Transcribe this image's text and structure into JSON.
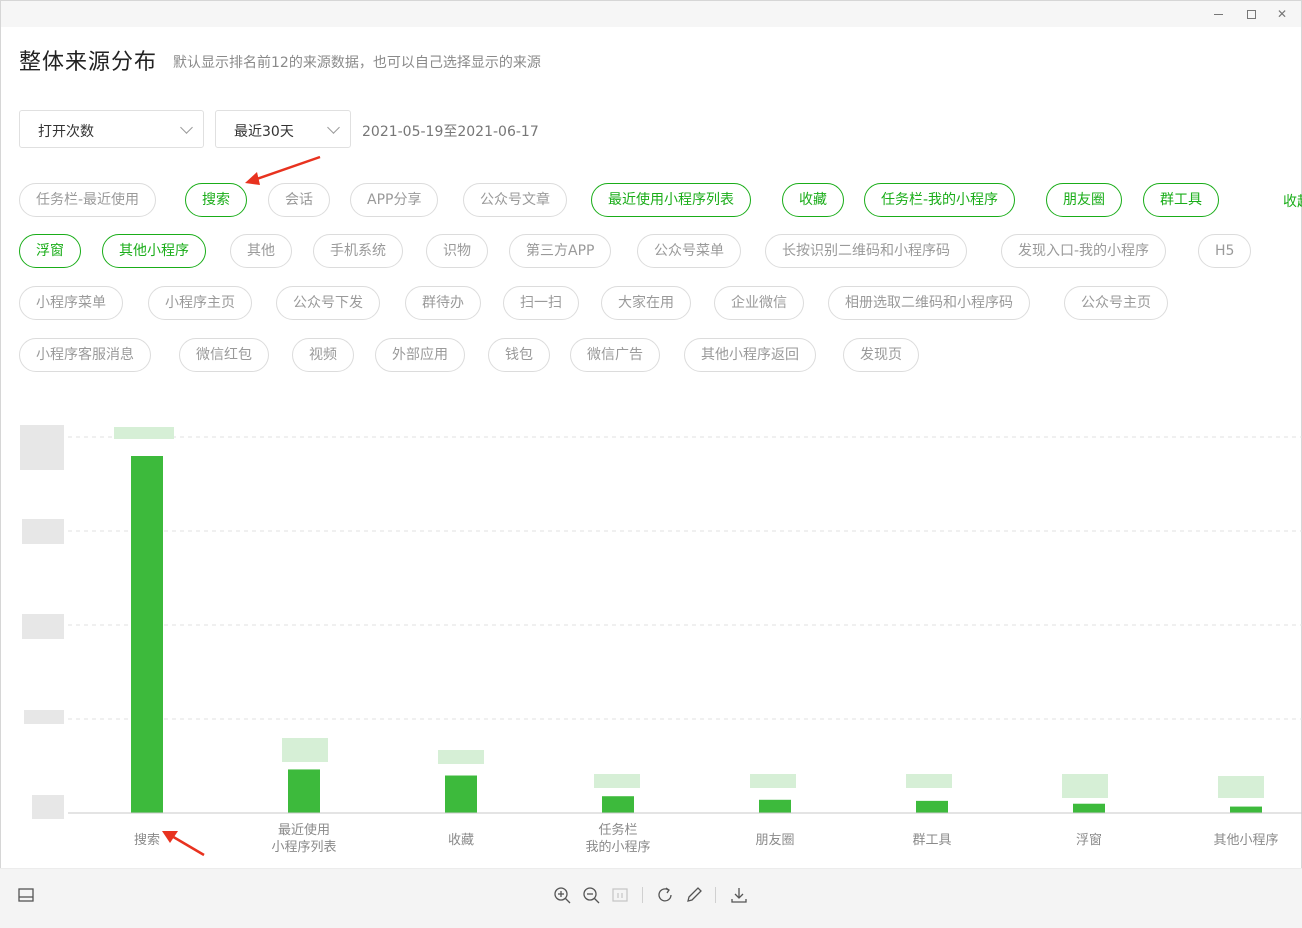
{
  "header": {
    "title": "整体来源分布",
    "subtitle": "默认显示排名前12的来源数据，也可以自己选择显示的来源"
  },
  "filters": {
    "metric": "打开次数",
    "range": "最近30天",
    "date_range": "2021-05-19至2021-06-17"
  },
  "tags_collapse_label": "收起",
  "tags": [
    {
      "label": "任务栏-最近使用",
      "selected": false
    },
    {
      "label": "搜索",
      "selected": true
    },
    {
      "label": "会话",
      "selected": false
    },
    {
      "label": "APP分享",
      "selected": false
    },
    {
      "label": "公众号文章",
      "selected": false
    },
    {
      "label": "最近使用小程序列表",
      "selected": true
    },
    {
      "label": "收藏",
      "selected": true
    },
    {
      "label": "任务栏-我的小程序",
      "selected": true
    },
    {
      "label": "朋友圈",
      "selected": true
    },
    {
      "label": "群工具",
      "selected": true
    },
    {
      "label": "浮窗",
      "selected": true
    },
    {
      "label": "其他小程序",
      "selected": true
    },
    {
      "label": "其他",
      "selected": false
    },
    {
      "label": "手机系统",
      "selected": false
    },
    {
      "label": "识物",
      "selected": false
    },
    {
      "label": "第三方APP",
      "selected": false
    },
    {
      "label": "公众号菜单",
      "selected": false
    },
    {
      "label": "长按识别二维码和小程序码",
      "selected": false
    },
    {
      "label": "发现入口-我的小程序",
      "selected": false
    },
    {
      "label": "H5",
      "selected": false
    },
    {
      "label": "小程序菜单",
      "selected": false
    },
    {
      "label": "小程序主页",
      "selected": false
    },
    {
      "label": "公众号下发",
      "selected": false
    },
    {
      "label": "群待办",
      "selected": false
    },
    {
      "label": "扫一扫",
      "selected": false
    },
    {
      "label": "大家在用",
      "selected": false
    },
    {
      "label": "企业微信",
      "selected": false
    },
    {
      "label": "相册选取二维码和小程序码",
      "selected": false
    },
    {
      "label": "公众号主页",
      "selected": false
    },
    {
      "label": "小程序客服消息",
      "selected": false
    },
    {
      "label": "微信红包",
      "selected": false
    },
    {
      "label": "视频",
      "selected": false
    },
    {
      "label": "外部应用",
      "selected": false
    },
    {
      "label": "钱包",
      "selected": false
    },
    {
      "label": "微信广告",
      "selected": false
    },
    {
      "label": "其他小程序返回",
      "selected": false
    },
    {
      "label": "发现页",
      "selected": false
    }
  ],
  "chart_data": {
    "type": "bar",
    "categories": [
      [
        "搜索"
      ],
      [
        "最近使用",
        "小程序列表"
      ],
      [
        "收藏"
      ],
      [
        "任务栏",
        "我的小程序"
      ],
      [
        "朋友圈"
      ],
      [
        "群工具"
      ],
      [
        "浮窗"
      ],
      [
        "其他小程序"
      ]
    ],
    "values": [
      100,
      12.2,
      10.5,
      4.7,
      3.7,
      3.4,
      2.6,
      1.8
    ],
    "ylim": [
      0,
      100
    ],
    "grid": true,
    "bar_color": "#3dba3c"
  },
  "toolbar": {
    "icons": [
      "layout-icon",
      "zoom-in-icon",
      "zoom-out-icon",
      "actual-size-icon",
      "rotate-icon",
      "edit-icon",
      "download-icon"
    ]
  }
}
